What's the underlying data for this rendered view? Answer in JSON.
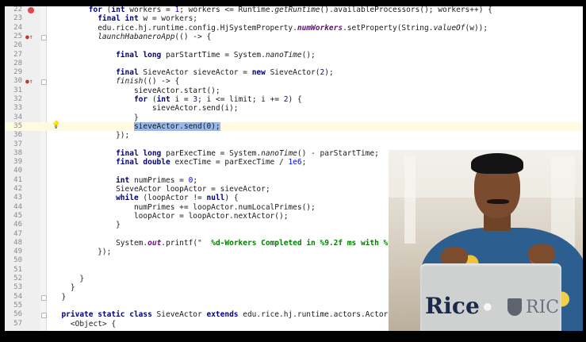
{
  "editor": {
    "lines": [
      {
        "num": "22",
        "marker": "breakpoint",
        "indent": 8,
        "tokens": [
          {
            "t": "for",
            "c": "kw"
          },
          {
            "t": " (",
            "c": ""
          },
          {
            "t": "int",
            "c": "kw"
          },
          {
            "t": " workers = ",
            "c": ""
          },
          {
            "t": "1",
            "c": "num"
          },
          {
            "t": "; workers <= Runtime.",
            "c": ""
          },
          {
            "t": "getRuntime",
            "c": "it"
          },
          {
            "t": "().availableProcessors(); workers++) {",
            "c": ""
          }
        ]
      },
      {
        "num": "23",
        "marker": "",
        "indent": 10,
        "tokens": [
          {
            "t": "final int",
            "c": "kw"
          },
          {
            "t": " w = workers;",
            "c": ""
          }
        ]
      },
      {
        "num": "24",
        "marker": "",
        "indent": 10,
        "tokens": [
          {
            "t": "edu.rice.hj.runtime.config.HjSystemProperty.",
            "c": ""
          },
          {
            "t": "numWorkers",
            "c": "fld"
          },
          {
            "t": ".setProperty(String.",
            "c": ""
          },
          {
            "t": "valueOf",
            "c": "it"
          },
          {
            "t": "(w));",
            "c": ""
          }
        ]
      },
      {
        "num": "25",
        "marker": "override",
        "indent": 10,
        "tokens": [
          {
            "t": "launchHabaneroApp",
            "c": "it"
          },
          {
            "t": "(() -> {",
            "c": ""
          }
        ]
      },
      {
        "num": "26",
        "marker": "",
        "indent": 0,
        "tokens": []
      },
      {
        "num": "27",
        "marker": "",
        "indent": 14,
        "tokens": [
          {
            "t": "final long",
            "c": "kw"
          },
          {
            "t": " parStartTime = System.",
            "c": ""
          },
          {
            "t": "nanoTime",
            "c": "it"
          },
          {
            "t": "();",
            "c": ""
          }
        ]
      },
      {
        "num": "28",
        "marker": "",
        "indent": 0,
        "tokens": []
      },
      {
        "num": "29",
        "marker": "",
        "indent": 14,
        "tokens": [
          {
            "t": "final",
            "c": "kw"
          },
          {
            "t": " SieveActor sieveActor = ",
            "c": ""
          },
          {
            "t": "new",
            "c": "kw"
          },
          {
            "t": " SieveActor(",
            "c": ""
          },
          {
            "t": "2",
            "c": "num"
          },
          {
            "t": ");",
            "c": ""
          }
        ]
      },
      {
        "num": "30",
        "marker": "override",
        "indent": 14,
        "tokens": [
          {
            "t": "finish",
            "c": "it"
          },
          {
            "t": "(() -> {",
            "c": ""
          }
        ]
      },
      {
        "num": "31",
        "marker": "",
        "indent": 18,
        "tokens": [
          {
            "t": "sieveActor.start();",
            "c": ""
          }
        ]
      },
      {
        "num": "32",
        "marker": "",
        "indent": 18,
        "tokens": [
          {
            "t": "for",
            "c": "kw"
          },
          {
            "t": " (",
            "c": ""
          },
          {
            "t": "int",
            "c": "kw"
          },
          {
            "t": " i = ",
            "c": ""
          },
          {
            "t": "3",
            "c": "num"
          },
          {
            "t": "; i <= limit; i += ",
            "c": ""
          },
          {
            "t": "2",
            "c": "num"
          },
          {
            "t": ") {",
            "c": ""
          }
        ]
      },
      {
        "num": "33",
        "marker": "",
        "indent": 22,
        "tokens": [
          {
            "t": "sieveActor.send(i);",
            "c": ""
          }
        ]
      },
      {
        "num": "34",
        "marker": "",
        "indent": 18,
        "tokens": [
          {
            "t": "}",
            "c": ""
          }
        ]
      },
      {
        "num": "35",
        "marker": "bulb",
        "indent": 18,
        "current": true,
        "tokens": [
          {
            "t": "sieveActor.send(",
            "c": "hl"
          },
          {
            "t": "0",
            "c": "hl num"
          },
          {
            "t": ");",
            "c": "hl"
          }
        ]
      },
      {
        "num": "36",
        "marker": "",
        "indent": 14,
        "tokens": [
          {
            "t": "});",
            "c": ""
          }
        ]
      },
      {
        "num": "37",
        "marker": "",
        "indent": 0,
        "tokens": []
      },
      {
        "num": "38",
        "marker": "",
        "indent": 14,
        "tokens": [
          {
            "t": "final long",
            "c": "kw"
          },
          {
            "t": " parExecTime = System.",
            "c": ""
          },
          {
            "t": "nanoTime",
            "c": "it"
          },
          {
            "t": "() - parStartTime;",
            "c": ""
          }
        ]
      },
      {
        "num": "39",
        "marker": "",
        "indent": 14,
        "tokens": [
          {
            "t": "final double",
            "c": "kw"
          },
          {
            "t": " execTime = parExecTime / ",
            "c": ""
          },
          {
            "t": "1e6",
            "c": "num"
          },
          {
            "t": ";",
            "c": ""
          }
        ]
      },
      {
        "num": "40",
        "marker": "",
        "indent": 0,
        "tokens": []
      },
      {
        "num": "41",
        "marker": "",
        "indent": 14,
        "tokens": [
          {
            "t": "int",
            "c": "kw"
          },
          {
            "t": " numPrimes = ",
            "c": ""
          },
          {
            "t": "0",
            "c": "num"
          },
          {
            "t": ";",
            "c": ""
          }
        ]
      },
      {
        "num": "42",
        "marker": "",
        "indent": 14,
        "tokens": [
          {
            "t": "SieveActor loopActor = sieveActor;",
            "c": ""
          }
        ]
      },
      {
        "num": "43",
        "marker": "",
        "indent": 14,
        "tokens": [
          {
            "t": "while",
            "c": "kw"
          },
          {
            "t": " (loopActor != ",
            "c": ""
          },
          {
            "t": "null",
            "c": "kw"
          },
          {
            "t": ") {",
            "c": ""
          }
        ]
      },
      {
        "num": "44",
        "marker": "",
        "indent": 18,
        "tokens": [
          {
            "t": "numPrimes += loopActor.numLocalPrimes();",
            "c": ""
          }
        ]
      },
      {
        "num": "45",
        "marker": "",
        "indent": 18,
        "tokens": [
          {
            "t": "loopActor = loopActor.nextActor();",
            "c": ""
          }
        ]
      },
      {
        "num": "46",
        "marker": "",
        "indent": 14,
        "tokens": [
          {
            "t": "}",
            "c": ""
          }
        ]
      },
      {
        "num": "47",
        "marker": "",
        "indent": 0,
        "tokens": []
      },
      {
        "num": "48",
        "marker": "",
        "indent": 14,
        "tokens": [
          {
            "t": "System.",
            "c": ""
          },
          {
            "t": "out",
            "c": "fld"
          },
          {
            "t": ".printf(\"  ",
            "c": ""
          },
          {
            "t": "%d-Workers Completed in %9.2f ms with %",
            "c": "str"
          }
        ]
      },
      {
        "num": "49",
        "marker": "",
        "indent": 10,
        "tokens": [
          {
            "t": "});",
            "c": ""
          }
        ]
      },
      {
        "num": "50",
        "marker": "",
        "indent": 0,
        "tokens": []
      },
      {
        "num": "51",
        "marker": "",
        "indent": 0,
        "tokens": []
      },
      {
        "num": "52",
        "marker": "",
        "indent": 6,
        "tokens": [
          {
            "t": "}",
            "c": ""
          }
        ]
      },
      {
        "num": "53",
        "marker": "",
        "indent": 4,
        "tokens": [
          {
            "t": "}",
            "c": ""
          }
        ]
      },
      {
        "num": "54",
        "marker": "",
        "indent": 2,
        "tokens": [
          {
            "t": "}",
            "c": ""
          }
        ]
      },
      {
        "num": "55",
        "marker": "",
        "indent": 0,
        "tokens": []
      },
      {
        "num": "56",
        "marker": "",
        "indent": 2,
        "tokens": [
          {
            "t": "private static class",
            "c": "kw"
          },
          {
            "t": " SieveActor ",
            "c": ""
          },
          {
            "t": "extends",
            "c": "kw"
          },
          {
            "t": " edu.rice.hj.runtime.actors.Actor",
            "c": ""
          }
        ]
      },
      {
        "num": "57",
        "marker": "",
        "indent": 4,
        "tokens": [
          {
            "t": "<Object> {",
            "c": ""
          }
        ]
      }
    ]
  },
  "speaker_overlay": {
    "laptop_logo_text": "Rice",
    "laptop_logo_small": "RIC"
  }
}
